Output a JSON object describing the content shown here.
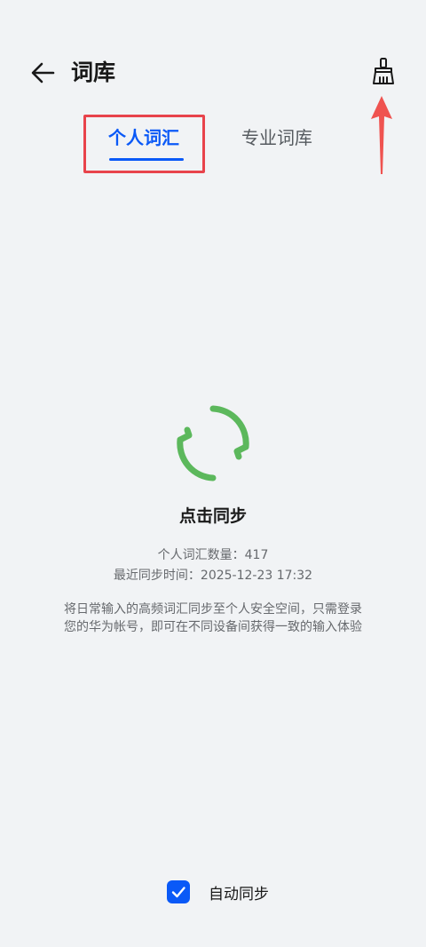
{
  "header": {
    "title": "词库",
    "back_icon": "arrow-left-icon",
    "clean_icon": "broom-icon"
  },
  "tabs": [
    {
      "label": "个人词汇",
      "active": true
    },
    {
      "label": "专业词库",
      "active": false
    }
  ],
  "sync": {
    "icon": "sync-icon",
    "action_label": "点击同步",
    "count_line": "个人词汇数量：417",
    "time_line": "最近同步时间：2025-12-23 17:32",
    "description_line1": "将日常输入的高频词汇同步至个人安全空间，只需登录",
    "description_line2": "您的华为帐号，即可在不同设备间获得一致的输入体验"
  },
  "auto_sync": {
    "label": "自动同步",
    "checked": true
  },
  "colors": {
    "accent": "#0a59f7",
    "sync_green": "#5cb85c",
    "annotation_red": "#e8434b",
    "background": "#f1f3f5"
  }
}
